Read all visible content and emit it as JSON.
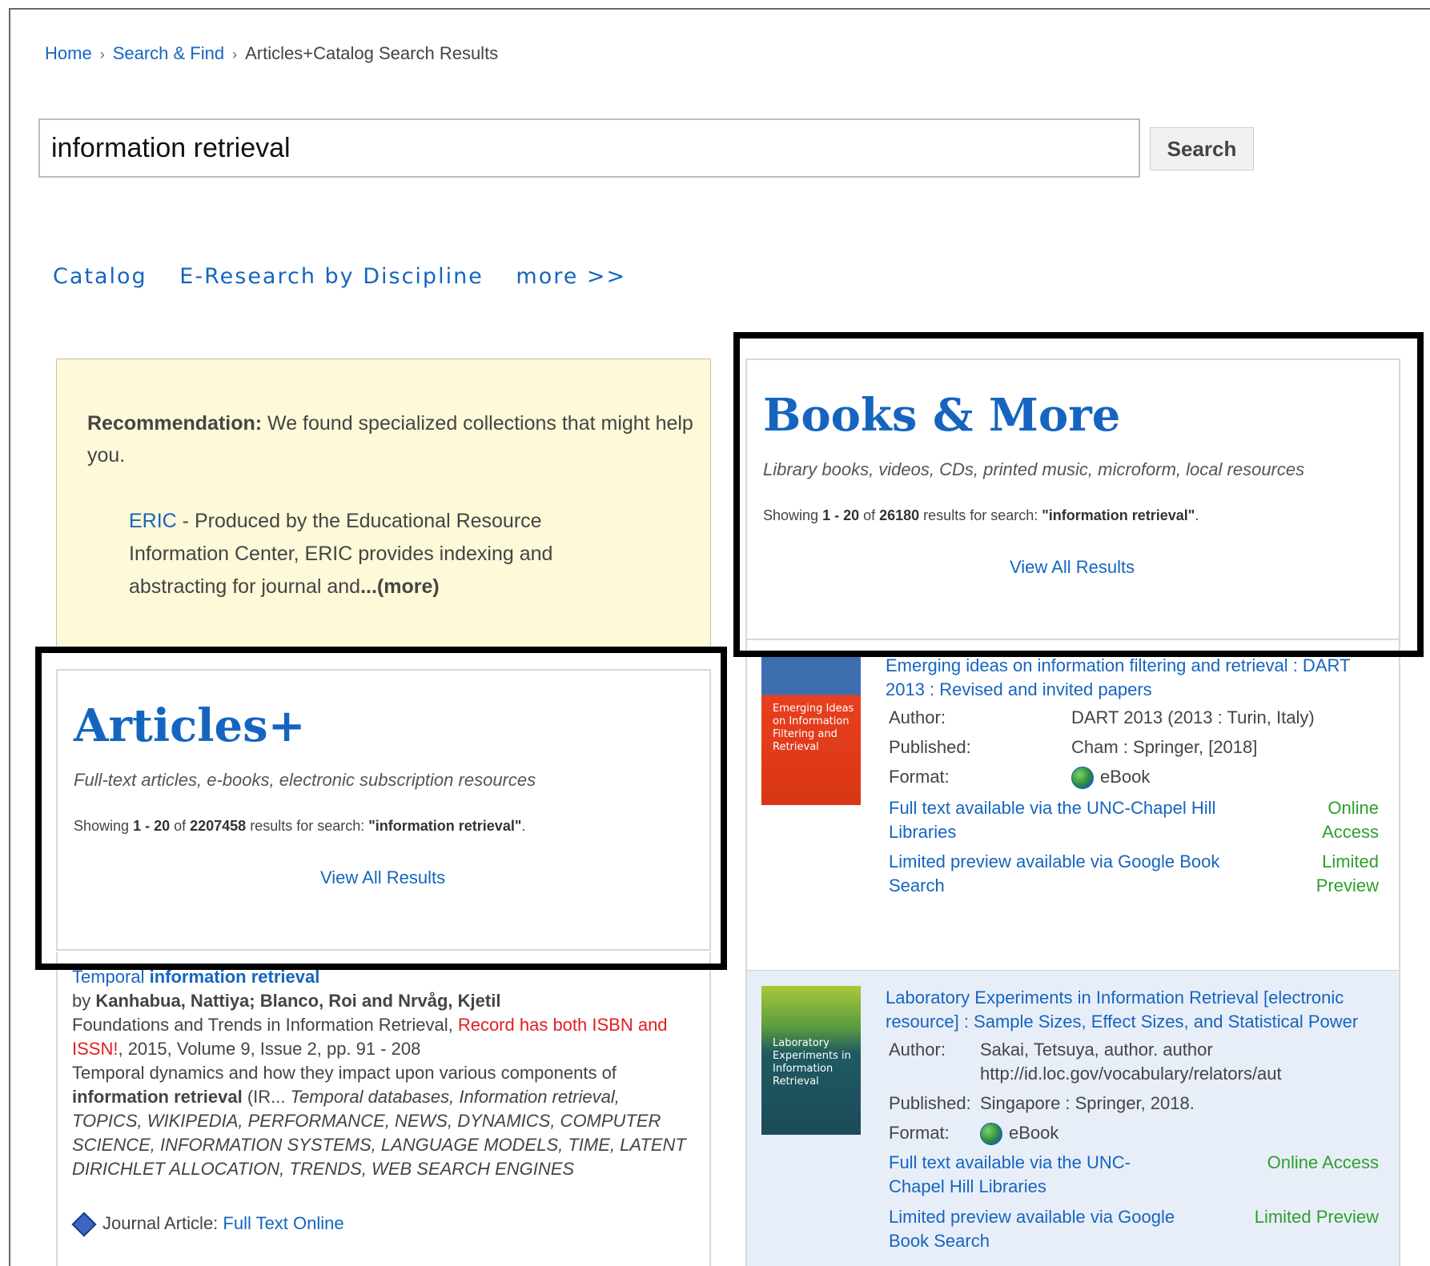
{
  "breadcrumb": {
    "home": "Home",
    "search_find": "Search & Find",
    "current": "Articles+Catalog Search Results",
    "separator": "›"
  },
  "search": {
    "value": "information retrieval",
    "button_label": "Search"
  },
  "tabs": {
    "catalog": "Catalog",
    "e_research": "E-Research by Discipline",
    "more": "more >>"
  },
  "recommendation": {
    "heading": "Recommendation:",
    "text": "We found specialized collections that might help you.",
    "eric_link": "ERIC",
    "eric_desc": " - Produced by the Educational Resource Information Center, ERIC provides indexing and abstracting for journal and",
    "ellipsis": "...",
    "more": "(more)"
  },
  "books_panel": {
    "title": "Books & More",
    "subtitle": "Library books, videos, CDs, printed music, microform, local resources",
    "count_prefix": "Showing ",
    "range": "1 - 20",
    "of": " of ",
    "total": "26180",
    "count_mid": " results for search: ",
    "query": "\"information retrieval\"",
    "count_end": ".",
    "view_all": "View All Results"
  },
  "articles_panel": {
    "title": "Articles+",
    "subtitle": "Full-text articles, e-books, electronic subscription resources",
    "count_prefix": "Showing ",
    "range": "1 - 20",
    "of": " of ",
    "total": "2207458",
    "count_mid": " results for search: ",
    "query": "\"information retrieval\"",
    "count_end": ".",
    "view_all": "View All Results"
  },
  "books": [
    {
      "title": "Emerging ideas on information filtering and retrieval : DART 2013 : Revised and invited papers",
      "cover_text": "Emerging Ideas on Information Filtering and Retrieval",
      "author_label": "Author:",
      "author": "DART 2013 (2013 : Turin, Italy)",
      "published_label": "Published:",
      "published": "Cham : Springer, [2018]",
      "format_label": "Format:",
      "format": "eBook",
      "full_text": "Full text available via the UNC-Chapel Hill Libraries",
      "full_text_status": "Online Access",
      "preview": "Limited preview available via Google Book Search",
      "preview_status": "Limited Preview"
    },
    {
      "title": "Laboratory Experiments in Information Retrieval [electronic resource] : Sample Sizes, Effect Sizes, and Statistical Power",
      "cover_text": "Laboratory Experiments in Information Retrieval",
      "author_label": "Author:",
      "author": "Sakai, Tetsuya, author. author http://id.loc.gov/vocabulary/relators/aut",
      "published_label": "Published:",
      "published": "Singapore : Springer, 2018.",
      "format_label": "Format:",
      "format": "eBook",
      "full_text": "Full text available via the UNC-Chapel Hill Libraries",
      "full_text_status": "Online Access",
      "preview": "Limited preview available via Google Book Search",
      "preview_status": "Limited Preview"
    }
  ],
  "article": {
    "title_prefix": "Temporal ",
    "title_bold": "information retrieval",
    "by": "by ",
    "authors": "Kanhabua, Nattiya; Blanco, Roi and Nrvåg, Kjetil",
    "source": "Foundations and Trends in Information Retrieval, ",
    "warning": "Record has both ISBN and ISSN!",
    "details": ", 2015, Volume 9, Issue 2, pp. 91 - 208",
    "abstract_start": "Temporal dynamics and how they impact upon various components of ",
    "abstract_bold": "information retrieval",
    "abstract_end": " (IR... ",
    "subjects": "Temporal databases, Information retrieval, TOPICS, WIKIPEDIA, PERFORMANCE, NEWS, DYNAMICS, COMPUTER SCIENCE, INFORMATION SYSTEMS, LANGUAGE MODELS, TIME, LATENT DIRICHLET ALLOCATION, TRENDS, WEB SEARCH ENGINES",
    "type": "Journal Article: ",
    "link": "Full Text Online"
  }
}
